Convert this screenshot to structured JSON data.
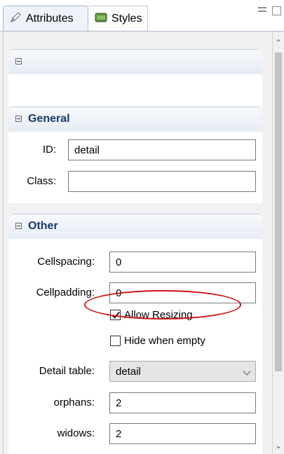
{
  "tabs": [
    {
      "label": "Attributes",
      "icon": "pencil-icon",
      "active": true
    },
    {
      "label": "Styles",
      "icon": "css-icon",
      "active": false
    }
  ],
  "sections": {
    "general": {
      "title": "General",
      "id_label": "ID:",
      "id_value": "detail",
      "class_label": "Class:",
      "class_value": ""
    },
    "other": {
      "title": "Other",
      "cellspacing_label": "Cellspacing:",
      "cellspacing_value": "0",
      "cellpadding_label": "Cellpadding:",
      "cellpadding_value": "0",
      "allow_resizing_label": "Allow Resizing",
      "allow_resizing_checked": true,
      "hide_when_empty_label": "Hide when empty",
      "hide_when_empty_checked": false,
      "detail_table_label": "Detail table:",
      "detail_table_value": "detail",
      "orphans_label": "orphans:",
      "orphans_value": "2",
      "widows_label": "widows:",
      "widows_value": "2"
    }
  },
  "colors": {
    "section_title": "#173a6b",
    "annotation": "#cc1111"
  }
}
